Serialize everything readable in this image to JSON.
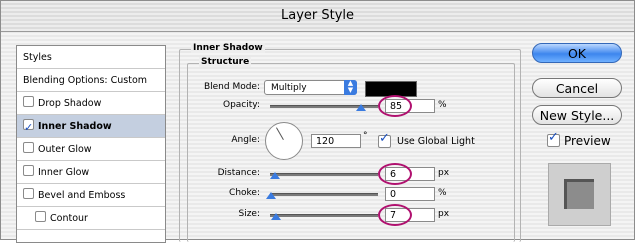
{
  "window": {
    "title": "Layer Style"
  },
  "stylelist": {
    "header": "Styles",
    "blending": "Blending Options: Custom",
    "items": [
      {
        "label": "Drop Shadow",
        "checked": false
      },
      {
        "label": "Inner Shadow",
        "checked": true
      },
      {
        "label": "Outer Glow",
        "checked": false
      },
      {
        "label": "Inner Glow",
        "checked": false
      },
      {
        "label": "Bevel and Emboss",
        "checked": false
      },
      {
        "label": "Contour",
        "checked": false
      }
    ]
  },
  "panel": {
    "group_title": "Inner Shadow",
    "subgroup_title": "Structure",
    "blend_mode_label": "Blend Mode:",
    "blend_mode_value": "Multiply",
    "shadow_color": "#000000",
    "opacity_label": "Opacity:",
    "opacity_value": "85",
    "opacity_unit": "%",
    "angle_label": "Angle:",
    "angle_value": "120",
    "angle_unit": "°",
    "global_light_label": "Use Global Light",
    "global_light_checked": true,
    "distance_label": "Distance:",
    "distance_value": "6",
    "distance_unit": "px",
    "choke_label": "Choke:",
    "choke_value": "0",
    "choke_unit": "%",
    "size_label": "Size:",
    "size_value": "7",
    "size_unit": "px"
  },
  "buttons": {
    "ok": "OK",
    "cancel": "Cancel",
    "new_style": "New Style...",
    "preview_label": "Preview",
    "preview_checked": true
  },
  "colors": {
    "highlight_circle": "#b0106f",
    "slider_thumb": "#3a7be0",
    "ok_button": "#3d86ee"
  }
}
